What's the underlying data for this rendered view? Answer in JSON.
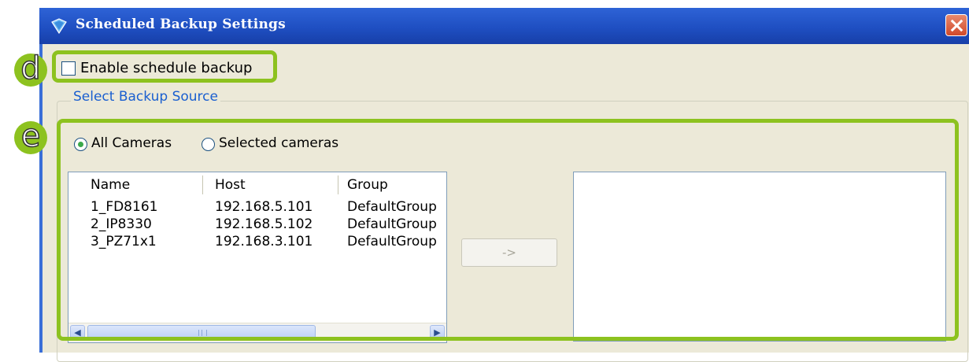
{
  "window": {
    "title": "Scheduled Backup Settings",
    "close_icon": "close-icon",
    "title_icon": "app-shield-icon"
  },
  "enable": {
    "label": "Enable schedule backup",
    "checked": false
  },
  "source_group": {
    "legend": "Select Backup Source",
    "radio_all": {
      "label": "All Cameras",
      "selected": true
    },
    "radio_selected": {
      "label": "Selected cameras",
      "selected": false
    }
  },
  "camera_list": {
    "columns": [
      "Name",
      "Host",
      "Group"
    ],
    "rows": [
      {
        "name": "1_FD8161",
        "host": "192.168.5.101",
        "group": "DefaultGroup"
      },
      {
        "name": "2_IP8330",
        "host": "192.168.5.102",
        "group": "DefaultGroup"
      },
      {
        "name": "3_PZ71x1",
        "host": "192.168.3.101",
        "group": "DefaultGroup"
      }
    ]
  },
  "move_button": {
    "label": "->",
    "enabled": false
  },
  "annotations": {
    "d": "d",
    "e": "e",
    "color": "#8dc21f"
  }
}
